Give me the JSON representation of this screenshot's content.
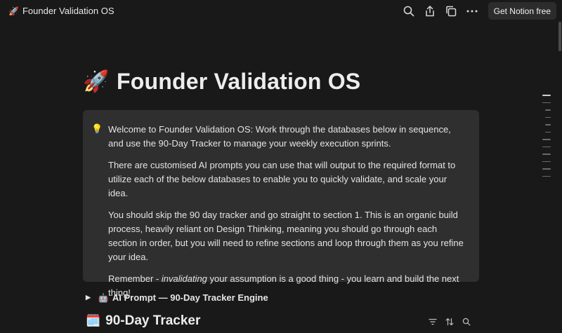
{
  "topbar": {
    "page_emoji": "🚀",
    "page_title": "Founder Validation OS",
    "get_notion_label": "Get Notion free"
  },
  "page": {
    "emoji": "🚀",
    "title": "Founder Validation OS"
  },
  "callout": {
    "icon": "💡",
    "paragraphs": [
      "Welcome to Founder Validation OS: Work through the databases below in sequence, and use the 90-Day Tracker to manage your weekly execution sprints.",
      "There are customised AI prompts you can use that will output to the required format to utilize each of the below databases to enable you to quickly validate, and scale your idea.",
      "You should skip the 90 day tracker and go straight to section 1. This is an organic build process, heavily reliant on Design Thinking, meaning you should go through each section in order, but you will need to refine sections and loop through them as you refine your idea."
    ],
    "last_paragraph": {
      "prefix": "Remember - ",
      "emphasis": "invalidating",
      "suffix": " your assumption is a good thing - you learn and build the next thing!"
    }
  },
  "toggle": {
    "emoji": "🤖",
    "label": "AI Prompt — 90-Day Tracker Engine"
  },
  "database": {
    "emoji": "🗓️",
    "title": "90-Day Tracker"
  },
  "icons": {
    "search": "search-icon",
    "share": "share-icon",
    "duplicate": "duplicate-icon",
    "more": "more-icon",
    "filter": "filter-icon",
    "sort": "sort-icon"
  },
  "colors": {
    "background": "#191919",
    "callout_background": "#2f2f2f",
    "text": "#e6e6e6"
  }
}
